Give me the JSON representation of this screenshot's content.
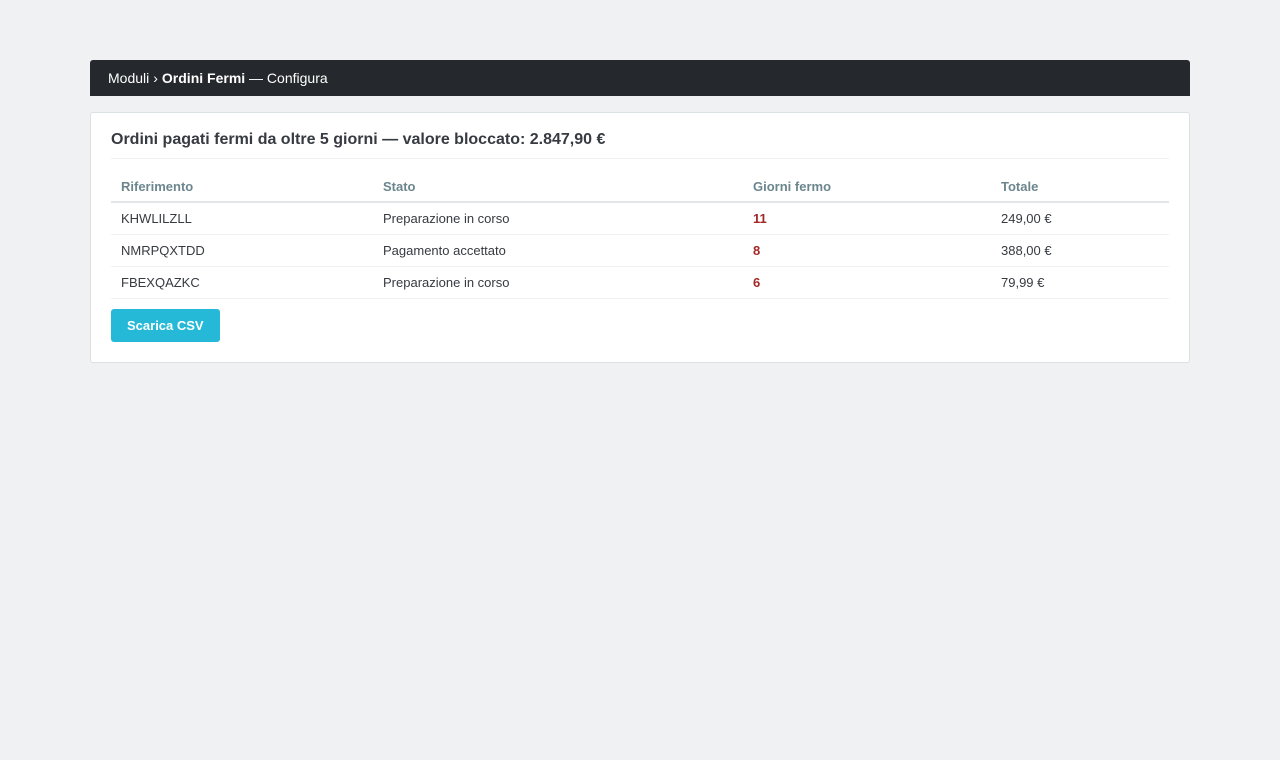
{
  "breadcrumb": {
    "root": "Moduli",
    "separator": "›",
    "module": "Ordini Fermi",
    "action": "— Configura"
  },
  "panel": {
    "title": "Ordini pagati fermi da oltre 5 giorni — valore bloccato: 2.847,90 €"
  },
  "table": {
    "headers": {
      "reference": "Riferimento",
      "status": "Stato",
      "days": "Giorni fermo",
      "total": "Totale"
    },
    "rows": [
      {
        "reference": "KHWLILZLL",
        "status": "Preparazione in corso",
        "days": "11",
        "total": "249,00 €"
      },
      {
        "reference": "NMRPQXTDD",
        "status": "Pagamento accettato",
        "days": "8",
        "total": "388,00 €"
      },
      {
        "reference": "FBEXQAZKC",
        "status": "Preparazione in corso",
        "days": "6",
        "total": "79,99 €"
      }
    ]
  },
  "actions": {
    "download_csv_label": "Scarica CSV"
  },
  "colors": {
    "header_bg": "#25282c",
    "page_bg": "#eff1f2",
    "accent": "#25b9d7",
    "days_highlight": "#a22727"
  }
}
